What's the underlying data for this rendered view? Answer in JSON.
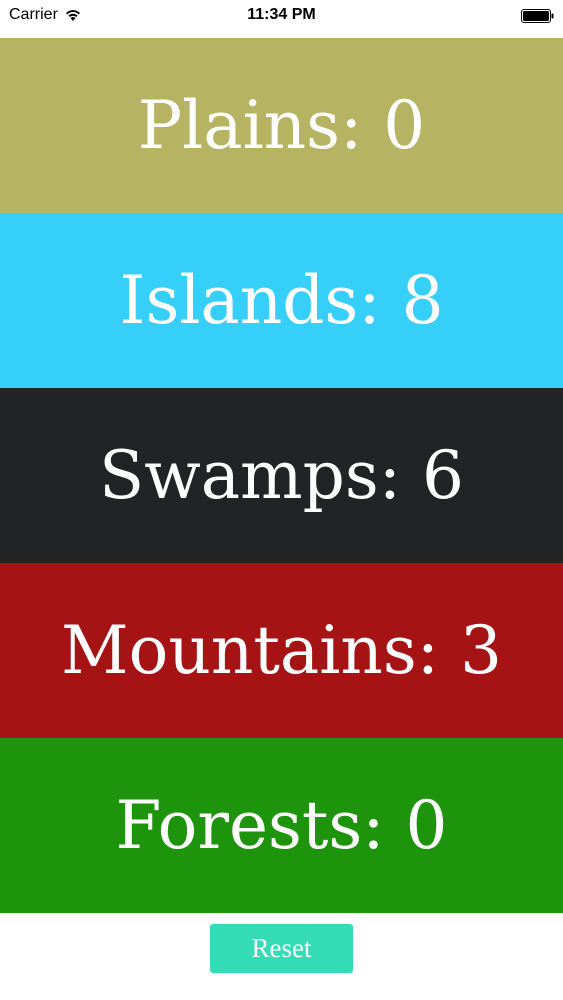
{
  "status_bar": {
    "carrier": "Carrier",
    "time": "11:34 PM"
  },
  "lands": [
    {
      "name": "Plains",
      "count": "0",
      "color": "#b6b362"
    },
    {
      "name": "Islands",
      "count": "8",
      "color": "#35cff9"
    },
    {
      "name": "Swamps",
      "count": "6",
      "color": "#222325"
    },
    {
      "name": "Mountains",
      "count": "3",
      "color": "#a61315"
    },
    {
      "name": "Forests",
      "count": "0",
      "color": "#1e940d"
    }
  ],
  "reset": {
    "label": "Reset",
    "color": "#33dcb4"
  }
}
